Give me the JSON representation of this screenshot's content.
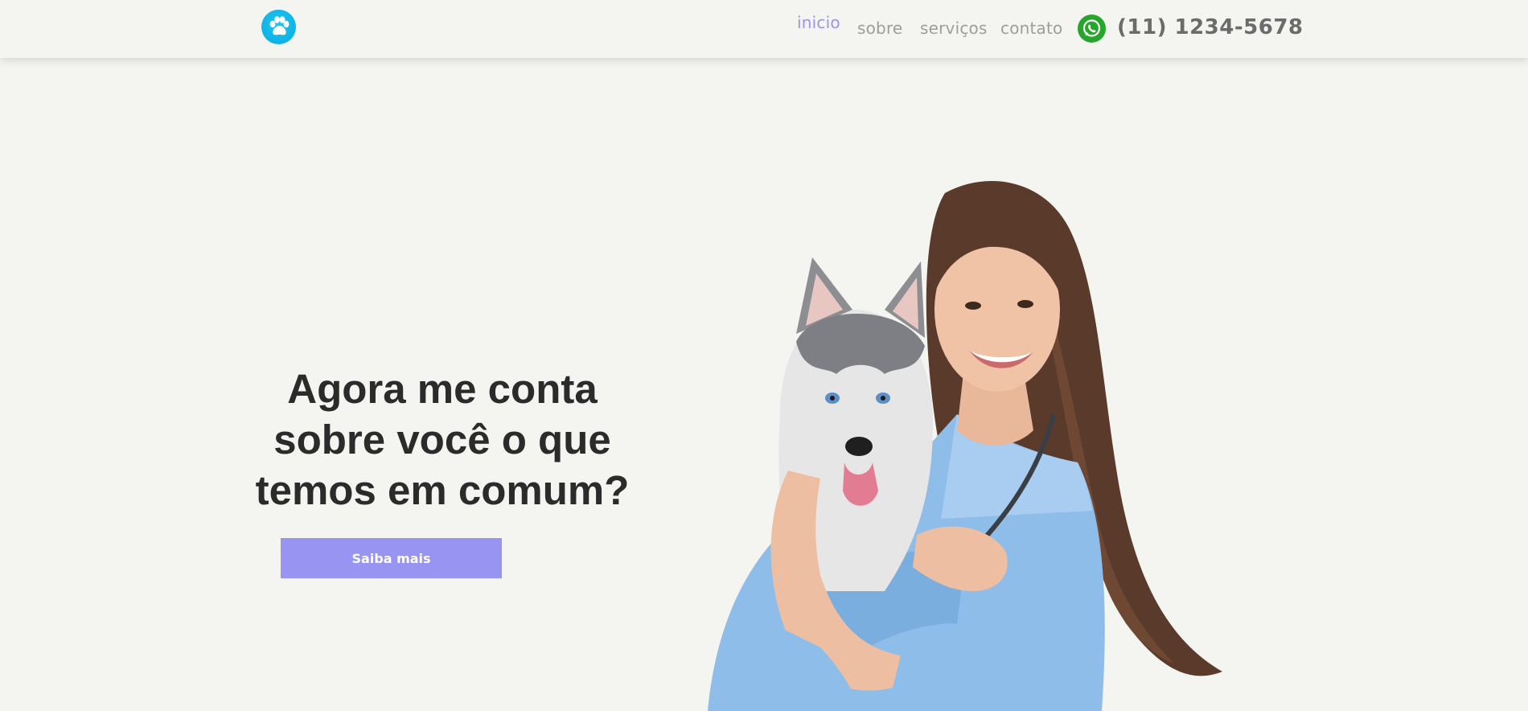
{
  "header": {
    "logo_icon": "paw-icon",
    "nav": [
      {
        "label": "inicio",
        "active": true
      },
      {
        "label": "sobre",
        "active": false
      },
      {
        "label": "serviços",
        "active": false
      },
      {
        "label": "contato",
        "active": false
      }
    ],
    "whatsapp_icon": "whatsapp-icon",
    "phone": "(11) 1234-5678"
  },
  "hero": {
    "title_lines": [
      "Agora me conta",
      "sobre você o que",
      "temos em comum?"
    ],
    "cta_label": "Saiba mais",
    "photo": "veterinarian-with-husky-puppy"
  },
  "colors": {
    "background": "#f4f4f1",
    "accent": "#9794f2",
    "active_nav": "#9b94ee",
    "logo": "#0fb3e6",
    "whatsapp": "#27a52d",
    "text_dark": "#2b2b2b",
    "nav_text": "#9d9d9d"
  }
}
